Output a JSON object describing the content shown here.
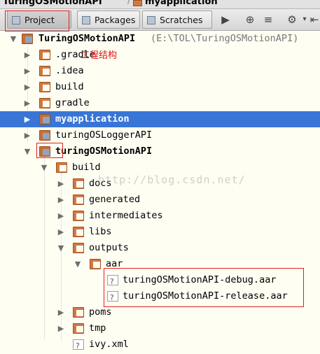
{
  "breadcrumb": {
    "items": [
      "TuringOSMotionAPI",
      "myapplication"
    ]
  },
  "toolbar": {
    "tabs": [
      {
        "label": "Project"
      },
      {
        "label": "Packages"
      },
      {
        "label": "Scratches"
      }
    ],
    "more_icon": "triangle-right-icon",
    "locate_icon": "crosshair-icon",
    "collapse_icon": "collapse-icon",
    "settings_icon": "gear-icon",
    "hide_icon": "hide-icon"
  },
  "tree": {
    "root": {
      "label": "TuringOSMotionAPI",
      "path": "(E:\\TOL\\TuringOSMotionAPI)"
    },
    "items": [
      {
        "label": ".gradle"
      },
      {
        "label": ".idea"
      },
      {
        "label": "build"
      },
      {
        "label": "gradle"
      },
      {
        "label": "myapplication"
      },
      {
        "label": "turingOSLoggerAPI"
      },
      {
        "label": "turingOSMotionAPI"
      },
      {
        "label": "build"
      },
      {
        "label": "docs"
      },
      {
        "label": "generated"
      },
      {
        "label": "intermediates"
      },
      {
        "label": "libs"
      },
      {
        "label": "outputs"
      },
      {
        "label": "aar"
      },
      {
        "label": "turingOSMotionAPI-debug.aar"
      },
      {
        "label": "turingOSMotionAPI-release.aar"
      },
      {
        "label": "poms"
      },
      {
        "label": "tmp"
      },
      {
        "label": "ivy.xml"
      }
    ]
  },
  "annotation": {
    "text": "工程结构",
    "color": "#e01010"
  },
  "watermark": {
    "text": "http://blog.csdn.net/"
  },
  "colors": {
    "selection": "#3875d7",
    "folder": "#d07a43",
    "annotation_box": "#e02020"
  }
}
